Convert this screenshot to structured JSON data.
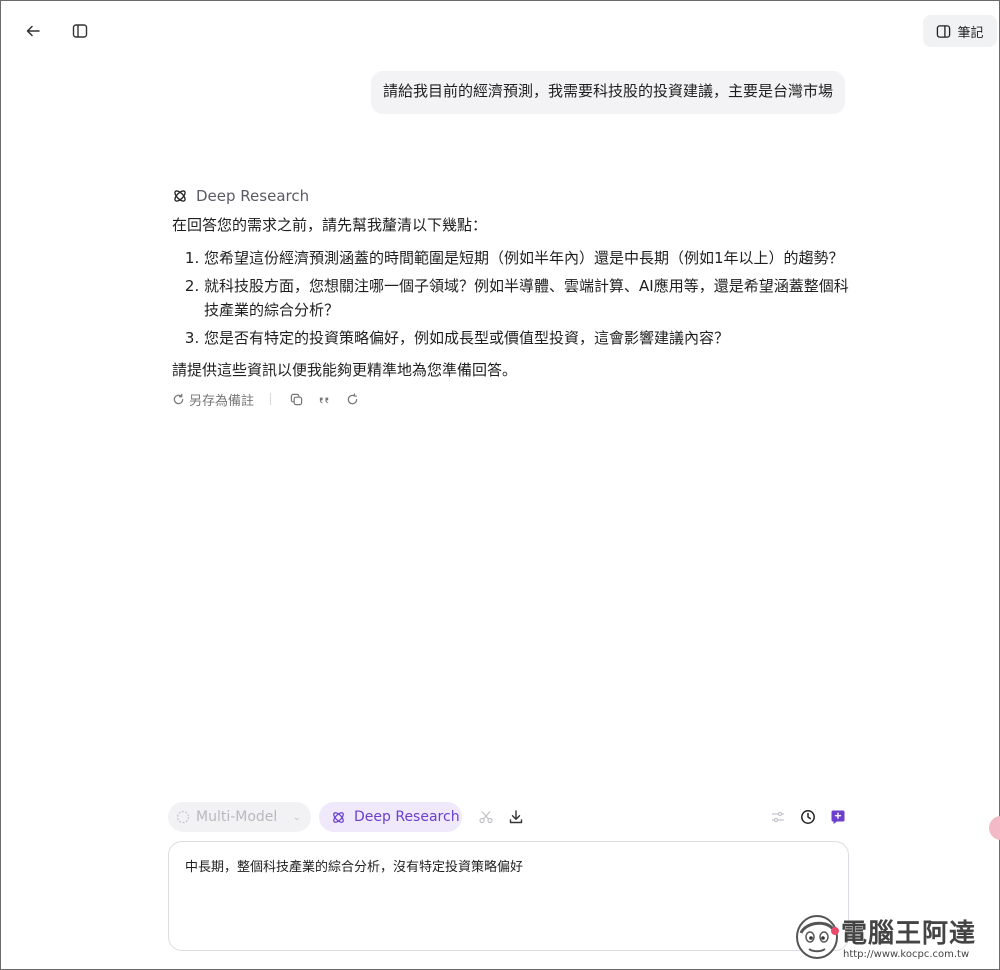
{
  "header": {
    "back_icon": "arrow-left-icon",
    "sidebar_icon": "sidebar-toggle-icon",
    "notes_label": "筆記"
  },
  "user_message": "請給我目前的經濟預測，我需要科技股的投資建議，主要是台灣市場",
  "answer": {
    "source_label": "Deep Research",
    "intro": "在回答您的需求之前，請先幫我釐清以下幾點：",
    "questions": [
      "您希望這份經濟預測涵蓋的時間範圍是短期（例如半年內）還是中長期（例如1年以上）的趨勢？",
      "就科技股方面，您想關注哪一個子領域？例如半導體、雲端計算、AI應用等，還是希望涵蓋整個科技產業的綜合分析？",
      "您是否有特定的投資策略偏好，例如成長型或價值型投資，這會影響建議內容？"
    ],
    "outro": "請提供這些資訊以便我能夠更精準地為您準備回答。",
    "actions": {
      "save_label": "另存為備註"
    }
  },
  "toolbar": {
    "model_placeholder": "Multi-Model",
    "deep_research_label": "Deep Research"
  },
  "input": {
    "value": "中長期，整個科技產業的綜合分析，沒有特定投資策略偏好"
  },
  "watermark": {
    "brand": "電腦王阿達",
    "url": "http://www.kocpc.com.tw"
  },
  "colors": {
    "accent": "#6c3fcf",
    "accent_bg": "#efe9fb",
    "bubble_bg": "#f3f3f5"
  }
}
